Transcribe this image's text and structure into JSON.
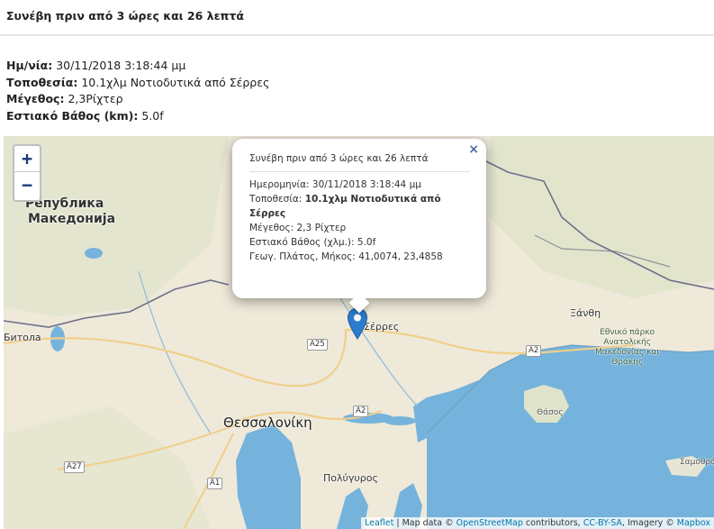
{
  "header": {
    "title": "Συνέβη πριν από 3 ώρες και 26 λεπτά"
  },
  "details": {
    "date_label": "Ημ/νία:",
    "date_value": "30/11/2018 3:18:44 μμ",
    "location_label": "Τοποθεσία:",
    "location_value": "10.1χλμ Νοτιοδυτικά από Σέρρες",
    "magnitude_label": "Μέγεθος:",
    "magnitude_value": "2,3Ρίχτερ",
    "depth_label": "Εστιακό Βάθος (km):",
    "depth_value": "5.0f"
  },
  "map": {
    "zoom_in": "+",
    "zoom_out": "−",
    "popup": {
      "close": "×",
      "title": "Συνέβη πριν από 3 ώρες και 26 λεπτά",
      "date_label": "Ημερομηνία:",
      "date_value": "30/11/2018 3:18:44 μμ",
      "location_label": "Τοποθεσία:",
      "location_value": "10.1χλμ Νοτιοδυτικά από Σέρρες",
      "magnitude_label": "Μέγεθος:",
      "magnitude_value": "2,3 Ρίχτερ",
      "depth_label": "Εστιακό Βάθος (χλμ.):",
      "depth_value": "5.0f",
      "coords_label": "Γεωγ. Πλάτος, Μήκος:",
      "coords_value": "41,0074, 23,4858"
    },
    "labels": {
      "macedonia_line1": "Република",
      "macedonia_line2": "Македонија",
      "bitola": "Битола",
      "thessaloniki": "Θεσσαλονίκη",
      "serres": "Σέρρες",
      "xanthi": "Ξάνθη",
      "polygyros": "Πολύγυρος",
      "thasos": "Θάσος",
      "samothraki": "Σαμοθρά",
      "park_line1": "Εθνικό πάρκο",
      "park_line2": "Ανατολικής",
      "park_line3": "Μακεδονίας και",
      "park_line4": "Θράκης"
    },
    "roads": {
      "a25": "A25",
      "a2_east": "A2",
      "a2_center": "A2",
      "a27": "A27",
      "a1": "A1"
    },
    "attribution": {
      "leaflet": "Leaflet",
      "sep1": " | Map data © ",
      "osm": "OpenStreetMap",
      "mid": " contributors, ",
      "license": "CC-BY-SA",
      "imagery": ", Imagery © ",
      "mapbox": "Mapbox"
    },
    "colors": {
      "land": "#eee9d9",
      "sea": "#75b3dc",
      "border": "#6f6f8a",
      "marker": "#2a7ccf"
    }
  }
}
